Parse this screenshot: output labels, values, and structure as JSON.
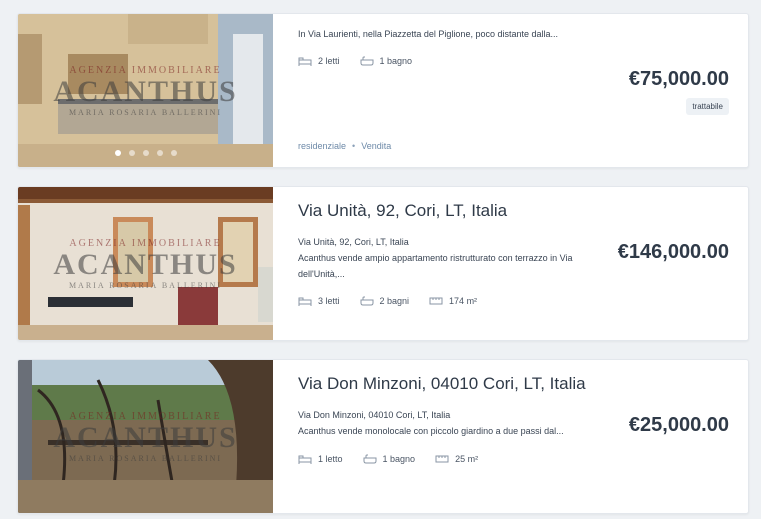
{
  "listings": [
    {
      "title": "",
      "description": "In Via Laurienti, nella Piazzetta del Piglione, poco distante dalla...",
      "beds": "2 letti",
      "baths": "1 bagno",
      "price": "€75,000.00",
      "badge": "trattabile",
      "tags": [
        "residenziale",
        "Vendita"
      ],
      "image": "building-photo",
      "watermark": {
        "agency": "AGENZIA IMMOBILIARE",
        "name": "ACANTHUS",
        "sub": "MARIA ROSARIA BALLERINI"
      }
    },
    {
      "title": "Via Unità, 92, Cori, LT, Italia",
      "address": "Via Unità, 92, Cori, LT, Italia",
      "description": "Acanthus vende ampio appartamento ristrutturato con terrazzo in Via dell'Unità,...",
      "beds": "3 letti",
      "baths": "2 bagni",
      "area": "174 m²",
      "price": "€146,000.00",
      "image": "living-room-photo",
      "watermark": {
        "agency": "AGENZIA IMMOBILIARE",
        "name": "ACANTHUS",
        "sub": "MARIA ROSARIA BALLERINI"
      }
    },
    {
      "title": "Via Don Minzoni, 04010 Cori, LT, Italia",
      "address": "Via Don Minzoni, 04010 Cori, LT, Italia",
      "description": "Acanthus vende monolocale con piccolo giardino a due passi dal...",
      "beds": "1 letto",
      "baths": "1 bagno",
      "area": "25 m²",
      "price": "€25,000.00",
      "image": "garden-view-photo",
      "watermark": {
        "agency": "AGENZIA IMMOBILIARE",
        "name": "ACANTHUS",
        "sub": "MARIA ROSARIA BALLERINI"
      }
    }
  ],
  "colors": {
    "background": "#eef1f4",
    "card": "#ffffff",
    "price": "#2f3a48",
    "tag": "#6e8aa8",
    "badge_bg": "#edf1f5"
  },
  "carousel": {
    "dots": 5,
    "active": 1
  }
}
